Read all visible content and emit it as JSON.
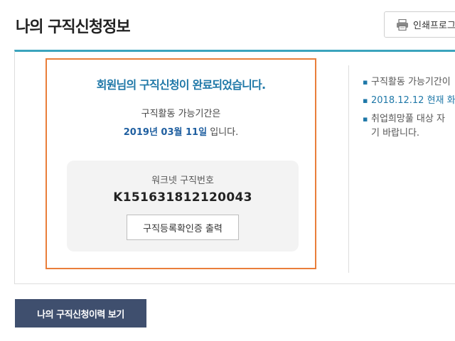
{
  "header": {
    "title": "나의 구직신청정보",
    "print_label": "인쇄프로그",
    "print_icon": "printer-icon"
  },
  "result": {
    "message": "회원님의 구직신청이 완료되었습니다.",
    "period_label": "구직활동 가능기간은",
    "period_date": "2019년 03월 11일",
    "period_suffix": " 입니다."
  },
  "worknet": {
    "label": "워크넷 구직번호",
    "number": "K151631812120043",
    "cert_button_label": "구직등록확인증 출력"
  },
  "notices": [
    {
      "text": "구직활동 가능기간이"
    },
    {
      "text": "2018.12.12 현재 화"
    },
    {
      "text": "취업희망풀 대상 자",
      "text2": "기 바랍니다."
    }
  ],
  "footer": {
    "history_button_label": "나의 구직신청이력 보기"
  },
  "colors": {
    "accent_teal": "#3ba4bd",
    "highlight_orange": "#e97e3a",
    "message_blue": "#1f78a8",
    "history_button_navy": "#3f4f6e"
  }
}
